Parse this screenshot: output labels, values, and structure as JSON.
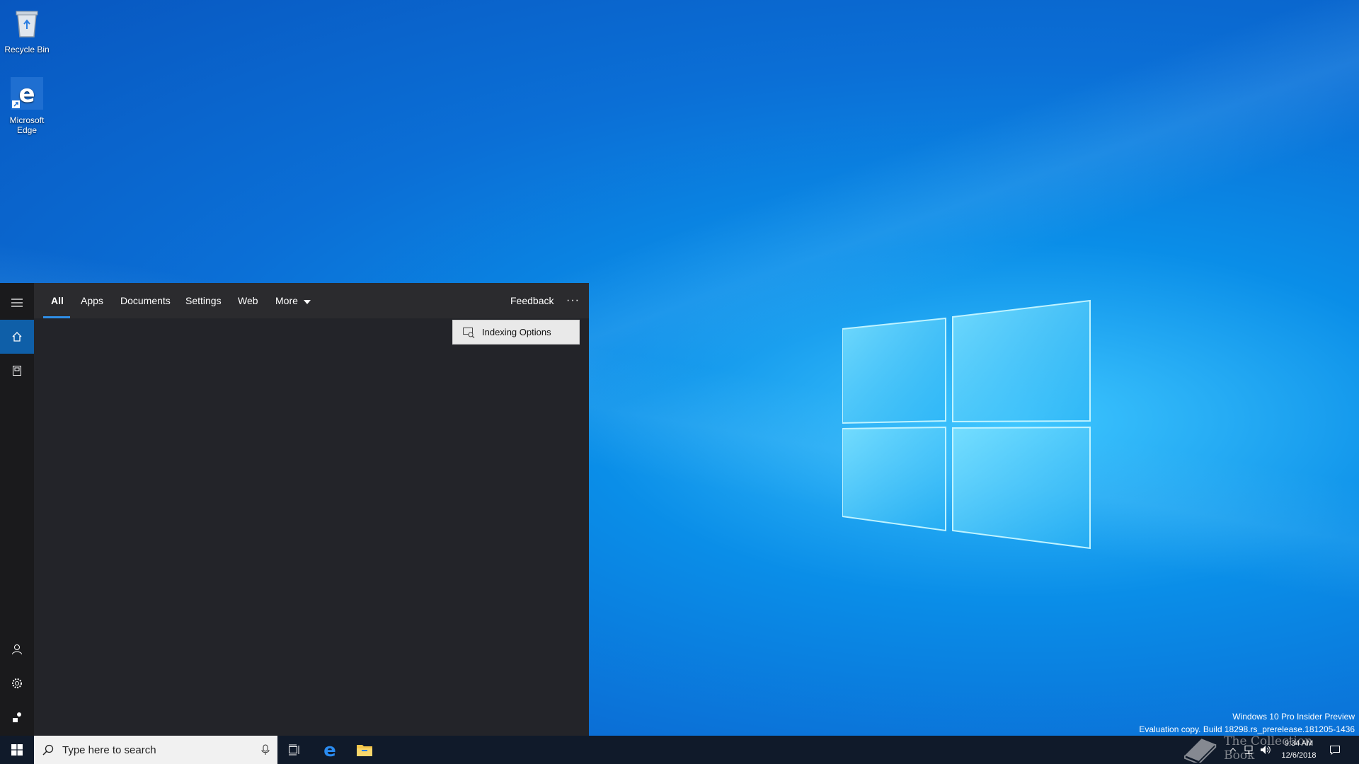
{
  "desktop": {
    "icons": [
      {
        "label": "Recycle Bin",
        "icon": "recycle-bin-icon"
      },
      {
        "label": "Microsoft Edge",
        "icon": "edge-icon"
      }
    ],
    "watermark": {
      "line1": "Windows 10 Pro Insider Preview",
      "line2": "Evaluation copy. Build 18298.rs_prerelease.181205-1436"
    },
    "brand_overlay": "The Collection Book"
  },
  "search_flyout": {
    "tabs": [
      {
        "label": "All",
        "selected": true
      },
      {
        "label": "Apps"
      },
      {
        "label": "Documents"
      },
      {
        "label": "Settings"
      },
      {
        "label": "Web"
      },
      {
        "label": "More"
      }
    ],
    "feedback_label": "Feedback",
    "more_options_label": "···",
    "overflow_menu": {
      "items": [
        {
          "label": "Indexing Options",
          "icon": "indexing-options-icon"
        }
      ]
    },
    "rail": {
      "top": [
        "hamburger-icon",
        "home-icon",
        "notebook-icon"
      ],
      "bottom": [
        "account-icon",
        "settings-icon",
        "feedback-hub-icon"
      ]
    }
  },
  "taskbar": {
    "search_placeholder": "Type here to search",
    "pinned": [
      "task-view-icon",
      "edge-icon",
      "file-explorer-icon"
    ],
    "clock": {
      "time": "9:34 AM",
      "date": "12/6/2018"
    }
  },
  "colors": {
    "accent": "#2f8ee6",
    "flyout_bg": "#232429",
    "taskbar_bg": "#101a2a"
  }
}
